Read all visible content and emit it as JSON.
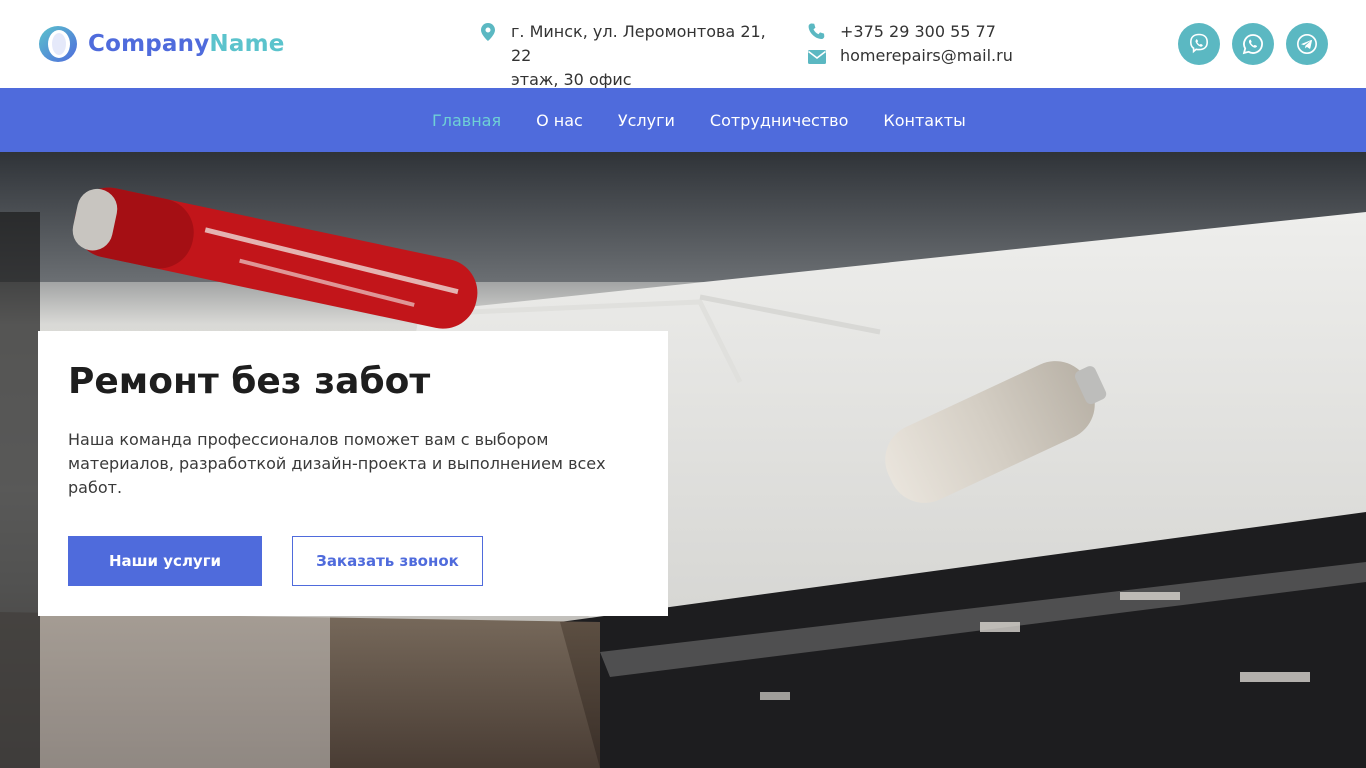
{
  "brand": {
    "name_part1": "Company",
    "name_part2": "Name",
    "primary_color": "#4f6bdc",
    "accent_color": "#5bc3cc"
  },
  "contacts": {
    "address_line1": "г. Минск, ул. Леромонтова 21, 22",
    "address_line2": "этаж, 30 офис",
    "phone": "+375 29 300 55 77",
    "email": "homerepairs@mail.ru"
  },
  "socials": [
    {
      "icon": "viber-icon"
    },
    {
      "icon": "whatsapp-icon"
    },
    {
      "icon": "telegram-icon"
    }
  ],
  "nav": {
    "items": [
      {
        "label": "Главная",
        "active": true
      },
      {
        "label": "О нас",
        "active": false
      },
      {
        "label": "Услуги",
        "active": false
      },
      {
        "label": "Сотрудничество",
        "active": false
      },
      {
        "label": "Контакты",
        "active": false
      }
    ]
  },
  "hero": {
    "title": "Ремонт без забот",
    "description": "Наша команда профессионалов поможет вам с выбором материалов, разработкой дизайн-проекта и выполнением всех работ.",
    "primary_button": "Наши услуги",
    "secondary_button": "Заказать звонок"
  }
}
